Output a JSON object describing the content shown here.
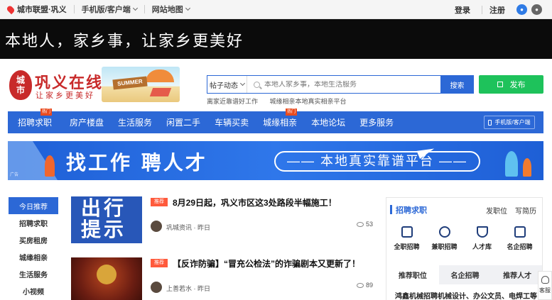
{
  "topbar": {
    "city": "城市联盟·巩义",
    "mobile": "手机版/客户端",
    "sitemap": "网站地图",
    "login": "登录",
    "register": "注册"
  },
  "slogan": "本地人，家乡事，让家乡更美好",
  "header": {
    "logo_badge_top": "城",
    "logo_badge_bottom": "市",
    "logo_title": "巩义在线",
    "logo_subtitle": "让家乡更美好",
    "summer_sign": "SUMMER"
  },
  "search": {
    "type_selector": "帖子动态",
    "placeholder": "本地人家乡事，本地生活服务",
    "button": "搜索",
    "hot_terms": [
      "离家近靠谱好工作",
      "城缘相亲本地真实相亲平台"
    ]
  },
  "publish_button": "发布",
  "nav": {
    "items": [
      "招聘求职",
      "房产楼盘",
      "生活服务",
      "闲置二手",
      "车辆买卖",
      "城缘相亲",
      "本地论坛",
      "更多服务"
    ],
    "badge": "热门",
    "client": "手机版/客户端"
  },
  "ad": {
    "headline": "找工作 聘人才",
    "pill": "—— 本地真实靠谱平台 ——",
    "tag": "广告"
  },
  "sidenav": {
    "items": [
      "今日推荐",
      "招聘求职",
      "买房租房",
      "城缘相亲",
      "生活服务",
      "小视频"
    ]
  },
  "articles": [
    {
      "thumb_text": "出行提示",
      "tag": "推荐",
      "title": "8月29日起，巩义市区这3处路段半幅施工！",
      "author": "巩城资讯",
      "time": "昨日",
      "views": "53"
    },
    {
      "tag": "推荐",
      "title": "【反诈防骗】“冒充公检法”的诈骗剧本又更新了！",
      "author": "上善若水",
      "time": "昨日",
      "views": "89"
    }
  ],
  "recruit": {
    "title": "招聘求职",
    "post_job": "发职位",
    "write_resume": "写简历",
    "icons": [
      {
        "icon": "briefcase-icon",
        "label": "全职招聘"
      },
      {
        "icon": "user-clock-icon",
        "label": "兼职招聘"
      },
      {
        "icon": "graduation-cap-icon",
        "label": "人才库"
      },
      {
        "icon": "company-icon",
        "label": "名企招聘"
      }
    ],
    "tabs": [
      "推荐职位",
      "名企招聘",
      "推荐人才"
    ],
    "first_job": "鸿鑫机械招聘机械设计、办公文员、电焊工等"
  },
  "service": "客服",
  "colors": {
    "brand_blue": "#2c68d6",
    "logo_red": "#c82a2a",
    "publish_green": "#1ec25b",
    "tag_red": "#ff5a3c"
  }
}
